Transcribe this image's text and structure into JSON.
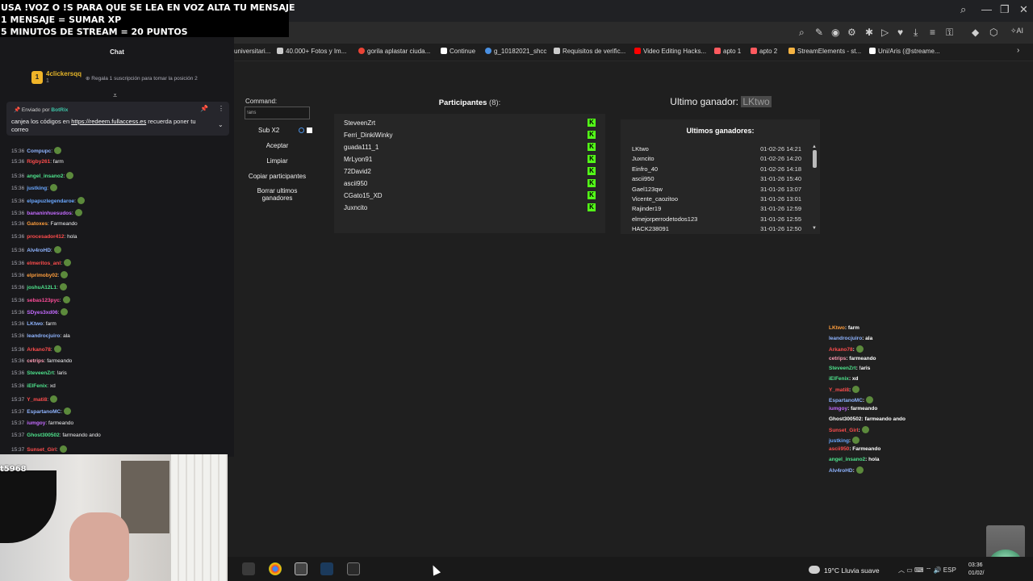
{
  "overlay": {
    "line1": "USA !VOZ O !S PARA QUE SE LEA EN VOZ ALTA TU MENSAJE",
    "line2": "1 MENSAJE = SUMAR XP",
    "line3": "5 MINUTOS DE STREAM = 20 PUNTOS"
  },
  "browser": {
    "bookmarks": [
      {
        "label": "universitari...",
        "color": "#4a90e2"
      },
      {
        "label": "40.000+ Fotos y Im...",
        "color": "#cccccc"
      },
      {
        "label": "gorila aplastar ciuda...",
        "color": "#ea4335"
      },
      {
        "label": "Continue",
        "color": "#ffffff"
      },
      {
        "label": "g_10182021_shcc",
        "color": "#4a90e2"
      },
      {
        "label": "Requisitos de verific...",
        "color": "#cccccc"
      },
      {
        "label": "Video Editing Hacks...",
        "color": "#ff0000"
      },
      {
        "label": "apto 1",
        "color": "#ff5a5f"
      },
      {
        "label": "apto 2",
        "color": "#ff5a5f"
      },
      {
        "label": "StreamElements - st...",
        "color": "#f5b342"
      },
      {
        "label": "Uni/Aris (@streame...",
        "color": "#ffffff"
      }
    ]
  },
  "chat": {
    "header": "Chat",
    "top_sub": {
      "name": "4clickersqq",
      "count": "1",
      "cta": "Regala 1 suscripción para tomar la posición 2"
    },
    "pinned": {
      "by_prefix": "Enviado por",
      "by_user": "BotRix",
      "msg_prefix": "canjea los códigos en",
      "link": "https://redeem.fullaccess.es",
      "msg_suffix": "recuerda poner tu correo"
    },
    "lines": [
      {
        "time": "15:36",
        "user": "Compupc",
        "color": "#8fb4ff",
        "text": ":"
      },
      {
        "time": "15:36",
        "user": "Rigby261",
        "color": "#ff4d4d",
        "text": ": farm"
      },
      {
        "time": "15:36",
        "user": "angel_insano2",
        "color": "#4ee38c",
        "text": ":"
      },
      {
        "time": "15:36",
        "user": "justking",
        "color": "#6aa7ff",
        "text": ":"
      },
      {
        "time": "15:36",
        "user": "elpapuzlegendaroe",
        "color": "#6aa7ff",
        "text": ":"
      },
      {
        "time": "15:36",
        "user": "bananinhuesudos",
        "color": "#c46bff",
        "text": ":"
      },
      {
        "time": "15:36",
        "user": "Gatoxes",
        "color": "#ff9e3d",
        "text": ": Farmeando"
      },
      {
        "time": "15:36",
        "user": "procesador412",
        "color": "#ff4d4d",
        "text": ": hola"
      },
      {
        "time": "15:36",
        "user": "Alv4roHD",
        "color": "#8fb4ff",
        "text": ":"
      },
      {
        "time": "15:36",
        "user": "elmeritos_anl",
        "color": "#ff4d4d",
        "text": ":"
      },
      {
        "time": "15:36",
        "user": "elprimoby02",
        "color": "#ff9e3d",
        "text": ":"
      },
      {
        "time": "15:36",
        "user": "joshuA12L1",
        "color": "#4ee38c",
        "text": ":"
      },
      {
        "time": "15:36",
        "user": "sebas123pyc",
        "color": "#ff4d9a",
        "text": ":"
      },
      {
        "time": "15:36",
        "user": "SDyes3xd06",
        "color": "#c46bff",
        "text": ":"
      },
      {
        "time": "15:36",
        "user": "LKtwo",
        "color": "#8fb4ff",
        "text": ": farm"
      },
      {
        "time": "15:36",
        "user": "leandrocjuiro",
        "color": "#8fb4ff",
        "text": ": ala"
      },
      {
        "time": "15:36",
        "user": "Arkano78",
        "color": "#ff4d4d",
        "text": ":"
      },
      {
        "time": "15:36",
        "user": "cetrips",
        "color": "#ff9eb6",
        "text": ": farmeando"
      },
      {
        "time": "15:36",
        "user": "SteveenZrt",
        "color": "#4ee38c",
        "text": ": !aris"
      },
      {
        "time": "15:36",
        "user": "iElFenix",
        "color": "#4ee38c",
        "text": ": xd"
      },
      {
        "time": "15:37",
        "user": "Y_mati8",
        "color": "#ff4d4d",
        "text": ":"
      },
      {
        "time": "15:37",
        "user": "EspartanoMC",
        "color": "#8fb4ff",
        "text": ":"
      },
      {
        "time": "15:37",
        "user": "iumgoy",
        "color": "#c46bff",
        "text": ": farmeando"
      },
      {
        "time": "15:37",
        "user": "Ghost300502",
        "color": "#4ee38c",
        "text": ": farmeando ando"
      },
      {
        "time": "15:37",
        "user": "Sunset_Girl",
        "color": "#ff4d4d",
        "text": ":"
      }
    ]
  },
  "webcam": {
    "tag": "t5968"
  },
  "sorteo": {
    "command_label": "Command:",
    "command_value": "!aris",
    "sub_label": "Sub X2",
    "btn_accept": "Aceptar",
    "btn_clear": "Limpiar",
    "btn_copy": "Copiar participantes",
    "btn_delete": "Borrar ultimos ganadores",
    "participants_title": "Participantes",
    "participants_count": "(8):",
    "participants": [
      "SteveenZrt",
      "Ferri_DinkiWinky",
      "guada111_1",
      "MrLyon91",
      "72David2",
      "ascii950",
      "CGato15_XD",
      "Juxncito"
    ],
    "last_winner_label": "Ultimo ganador:",
    "last_winner": "LKtwo",
    "winners_title": "Ultimos ganadores:",
    "winners": [
      {
        "name": "LKtwo",
        "date": "01-02-26 14:21"
      },
      {
        "name": "Juxncito",
        "date": "01-02-26 14:20"
      },
      {
        "name": "Einfro_40",
        "date": "01-02-26 14:18"
      },
      {
        "name": "ascii950",
        "date": "31-01-26 15:40"
      },
      {
        "name": "Gael123qw",
        "date": "31-01-26 13:07"
      },
      {
        "name": "Vicente_caozitoo",
        "date": "31-01-26 13:01"
      },
      {
        "name": "Rajinder19",
        "date": "31-01-26 12:59"
      },
      {
        "name": "elmejorperrodetodos123",
        "date": "31-01-26 12:55"
      },
      {
        "name": "HACK238091",
        "date": "31-01-26 12:50"
      }
    ]
  },
  "right_chat": [
    {
      "user": "LKtwo",
      "color": "#ff9e3d",
      "text": ": farm"
    },
    {
      "user": "leandrocjuiro",
      "color": "#8fb4ff",
      "text": ": ala"
    },
    {
      "user": "Arkano78",
      "color": "#ff4d4d",
      "text": ":"
    },
    {
      "user": "cetrips",
      "color": "#ff9eb6",
      "text": ": farmeando"
    },
    {
      "user": "SteveenZrt",
      "color": "#4ee38c",
      "text": ": !aris"
    },
    {
      "user": "iElFenix",
      "color": "#4ee38c",
      "text": ": xd"
    },
    {
      "user": "Y_mati8",
      "color": "#ff4d4d",
      "text": ":"
    },
    {
      "user": "EspartanoMC",
      "color": "#8fb4ff",
      "text": ":"
    },
    {
      "user": "iumgoy",
      "color": "#c46bff",
      "text": ": farmeando"
    },
    {
      "user": "Ghost300502",
      "color": "#ffffff",
      "text": ": farmeando ando"
    },
    {
      "user": "Sunset_Girl",
      "color": "#ff4d4d",
      "text": ":"
    },
    {
      "user": "justking",
      "color": "#6aa7ff",
      "text": ":"
    },
    {
      "user": "ascii950",
      "color": "#ff4d4d",
      "text": ": Farmeando"
    },
    {
      "user": "angel_insano2",
      "color": "#4ee38c",
      "text": ": hola"
    },
    {
      "user": "Alv4roHD",
      "color": "#8fb4ff",
      "text": ":"
    }
  ],
  "taskbar": {
    "weather": "19°C  Lluvia suave",
    "lang": "ESP",
    "time": "03:36",
    "date": "01/02/"
  }
}
